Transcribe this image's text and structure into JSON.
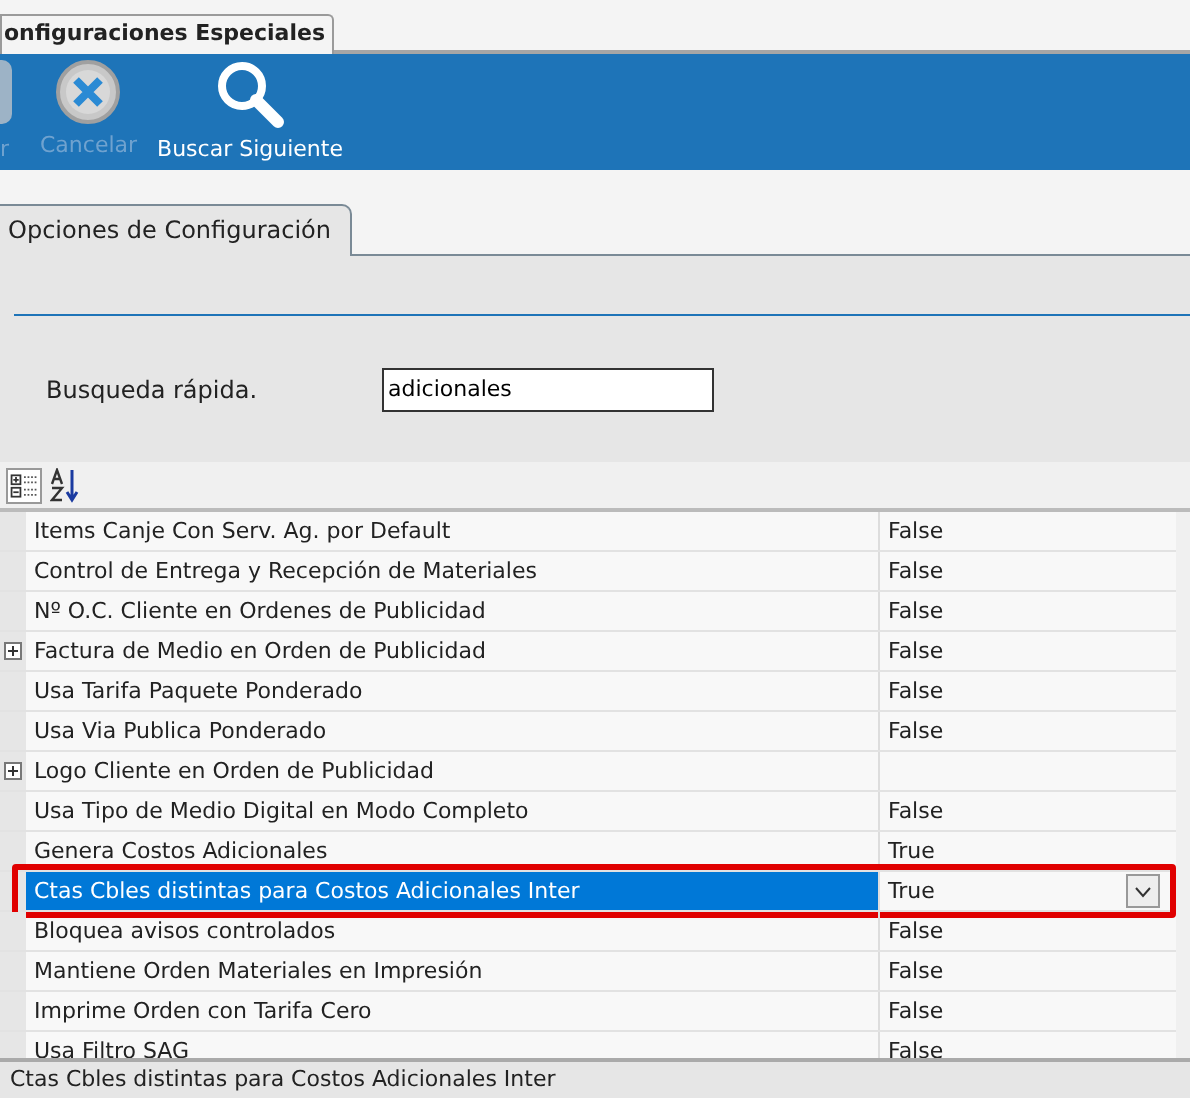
{
  "document_tab": {
    "label": "onfiguraciones Especiales",
    "selected": true
  },
  "toolbar": [
    {
      "kind": "accept",
      "label": "r",
      "disabled": true
    },
    {
      "kind": "cancel",
      "label": "Cancelar",
      "disabled": true
    },
    {
      "kind": "search",
      "label": "Buscar Siguiente",
      "disabled": false
    }
  ],
  "section_tab": {
    "label": "Opciones de Configuración",
    "selected": true
  },
  "quick_search": {
    "label": "Busqueda rápida.",
    "value": "adicionales"
  },
  "property_grid": {
    "rows": [
      {
        "name": "Items Canje Con Serv. Ag. por Default",
        "value": "False",
        "expandable": false,
        "selected": false
      },
      {
        "name": "Control de Entrega y Recepción de Materiales",
        "value": "False",
        "expandable": false,
        "selected": false
      },
      {
        "name": "Nº O.C. Cliente en Ordenes de Publicidad",
        "value": "False",
        "expandable": false,
        "selected": false
      },
      {
        "name": "Factura de Medio en Orden de Publicidad",
        "value": "False",
        "expandable": true,
        "selected": false
      },
      {
        "name": "Usa Tarifa Paquete Ponderado",
        "value": "False",
        "expandable": false,
        "selected": false
      },
      {
        "name": "Usa Via Publica Ponderado",
        "value": "False",
        "expandable": false,
        "selected": false
      },
      {
        "name": "Logo Cliente en Orden de Publicidad",
        "expandable": true,
        "selected": false
      },
      {
        "name": "Usa Tipo de Medio Digital en Modo Completo",
        "value": "False",
        "expandable": false,
        "selected": false
      },
      {
        "name": "Genera Costos Adicionales",
        "value": "True",
        "expandable": false,
        "selected": false
      },
      {
        "name": "Ctas Cbles distintas para Costos Adicionales Inter",
        "value": "True",
        "expandable": false,
        "selected": true,
        "highlighted": true
      },
      {
        "name": "Bloquea avisos controlados",
        "value": "False",
        "expandable": false,
        "selected": false
      },
      {
        "name": "Mantiene Orden Materiales en Impresión",
        "value": "False",
        "expandable": false,
        "selected": false
      },
      {
        "name": "Imprime Orden con Tarifa Cero",
        "value": "False",
        "expandable": false,
        "selected": false
      },
      {
        "name": "Usa Filtro SAG",
        "value": "False",
        "expandable": false,
        "selected": false
      }
    ]
  },
  "status_bar": {
    "text": "Ctas Cbles distintas para Costos Adicionales Inter"
  }
}
